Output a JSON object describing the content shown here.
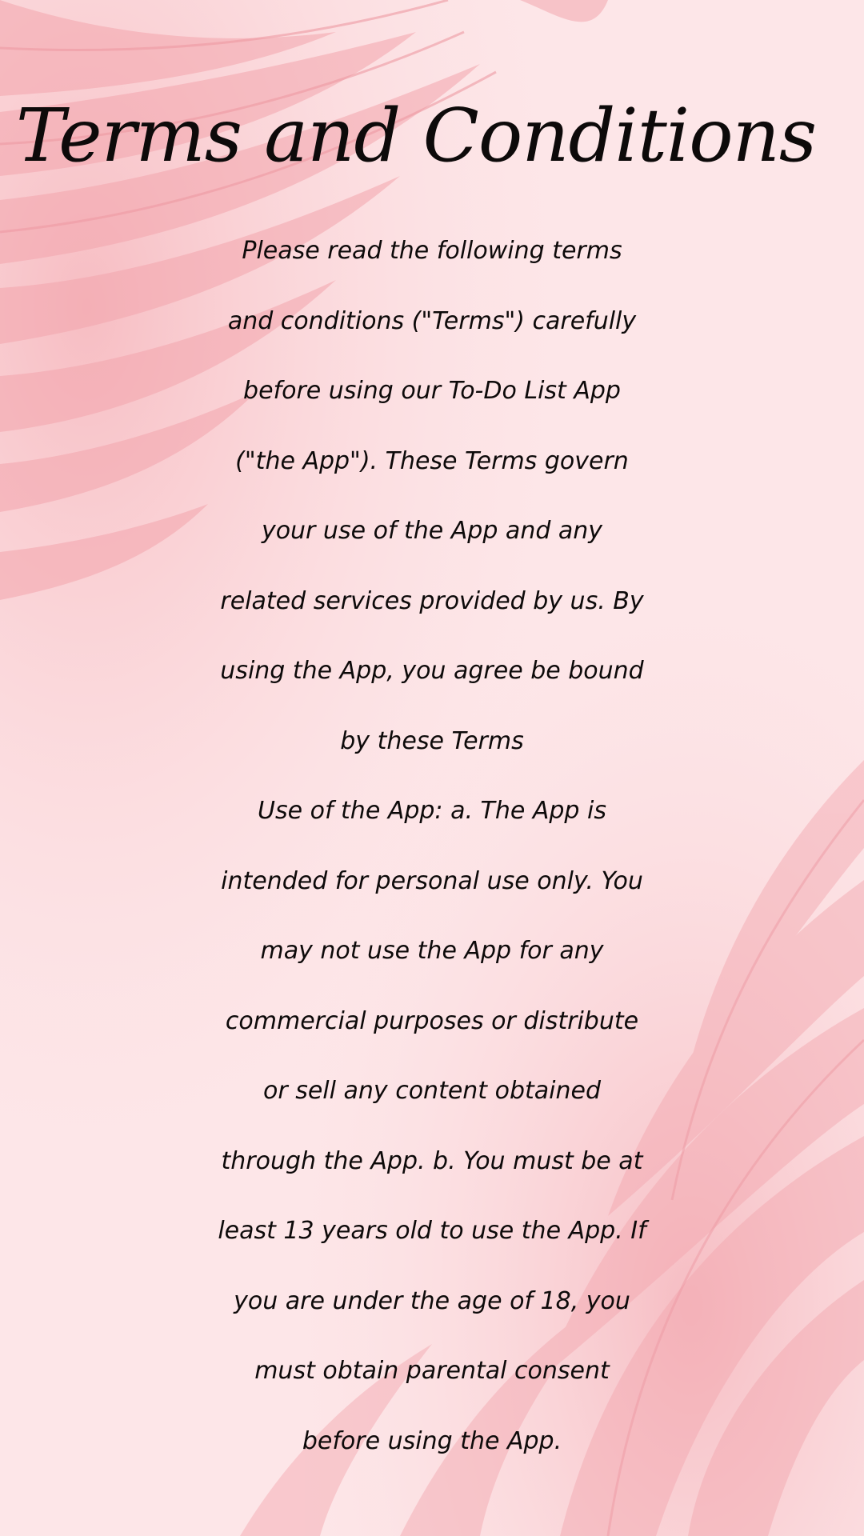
{
  "colors": {
    "background": "#fde6e8",
    "leaf": "#f3a5ad",
    "text": "#0d0a0a"
  },
  "page": {
    "title": "Terms and Conditions",
    "lines": [
      "Please read the following terms",
      "and conditions (\"Terms\") carefully",
      "before using our To-Do List App",
      "(\"the App\"). These Terms govern",
      "your use of the App and any",
      "related services provided by us. By",
      "using the App, you agree be bound",
      "by these Terms",
      "Use of the App: a. The App is",
      "intended for personal use only. You",
      "may not use the App for any",
      "commercial purposes or distribute",
      "or sell any content obtained",
      "through the App. b. You must be at",
      "least 13 years old to use the App. If",
      "you are under the age of 18, you",
      "must obtain parental consent",
      "before using the App."
    ]
  }
}
